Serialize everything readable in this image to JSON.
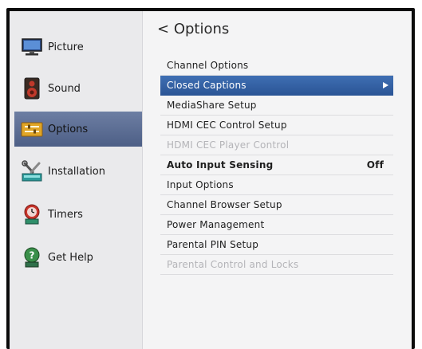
{
  "sidebar": {
    "items": [
      {
        "label": "Picture",
        "icon": "monitor-icon"
      },
      {
        "label": "Sound",
        "icon": "speaker-icon"
      },
      {
        "label": "Options",
        "icon": "options-icon",
        "active": true
      },
      {
        "label": "Installation",
        "icon": "tools-icon"
      },
      {
        "label": "Timers",
        "icon": "alarm-clock-icon"
      },
      {
        "label": "Get Help",
        "icon": "help-icon"
      }
    ]
  },
  "header": {
    "back_symbol": "<",
    "title": "Options"
  },
  "menu": {
    "items": [
      {
        "label": "Channel Options"
      },
      {
        "label": "Closed Captions",
        "selected": true
      },
      {
        "label": "MediaShare Setup"
      },
      {
        "label": "HDMI CEC Control Setup"
      },
      {
        "label": "HDMI CEC Player Control",
        "disabled": true
      },
      {
        "label": "Auto Input Sensing",
        "value": "Off"
      },
      {
        "label": "Input Options"
      },
      {
        "label": "Channel Browser Setup"
      },
      {
        "label": "Power Management"
      },
      {
        "label": "Parental PIN Setup"
      },
      {
        "label": "Parental Control and Locks",
        "disabled": true
      }
    ]
  },
  "colors": {
    "selected_row": "#2f5fa4",
    "active_sidebar": "#5a6b91",
    "disabled_text": "#b4b4b8"
  }
}
